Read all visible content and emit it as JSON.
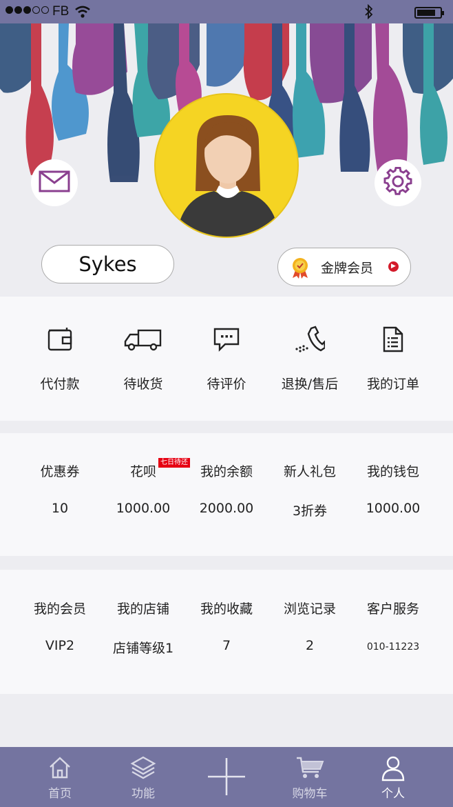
{
  "status_bar": {
    "carrier": "FB",
    "signal_icon": "signal-dots-icon",
    "wifi_icon": "wifi-icon",
    "bluetooth_icon": "bluetooth-icon",
    "battery_icon": "battery-icon"
  },
  "profile": {
    "username": "Sykes",
    "membership_label": "金牌会员",
    "mail_icon": "mail-icon",
    "settings_icon": "gear-icon"
  },
  "orders": [
    {
      "label": "代付款",
      "icon": "wallet-icon"
    },
    {
      "label": "待收货",
      "icon": "truck-icon"
    },
    {
      "label": "待评价",
      "icon": "comment-icon"
    },
    {
      "label": "退换/售后",
      "icon": "phone-icon"
    },
    {
      "label": "我的订单",
      "icon": "document-icon"
    }
  ],
  "finance": [
    {
      "label": "优惠券",
      "value": "10"
    },
    {
      "label": "花呗",
      "value": "1000.00",
      "badge": "七日待还"
    },
    {
      "label": "我的余额",
      "value": "2000.00"
    },
    {
      "label": "新人礼包",
      "value": "3折券"
    },
    {
      "label": "我的钱包",
      "value": "1000.00"
    }
  ],
  "services": [
    {
      "label": "我的会员",
      "value": "VIP2"
    },
    {
      "label": "我的店铺",
      "value": "店铺等级1"
    },
    {
      "label": "我的收藏",
      "value": "7"
    },
    {
      "label": "浏览记录",
      "value": "2"
    },
    {
      "label": "客户服务",
      "value": "010-11223"
    }
  ],
  "tabbar": [
    {
      "label": "首页",
      "icon": "home-icon",
      "active": false
    },
    {
      "label": "功能",
      "icon": "layers-icon",
      "active": false
    },
    {
      "label": "",
      "icon": "plus-icon",
      "active": false
    },
    {
      "label": "购物车",
      "icon": "cart-icon",
      "active": false
    },
    {
      "label": "个人",
      "icon": "person-icon",
      "active": true
    }
  ],
  "colors": {
    "accent": "#7474a0",
    "avatar_bg": "#f5d423",
    "badge": "#e60012",
    "icon_purple": "#8a3f8f"
  }
}
